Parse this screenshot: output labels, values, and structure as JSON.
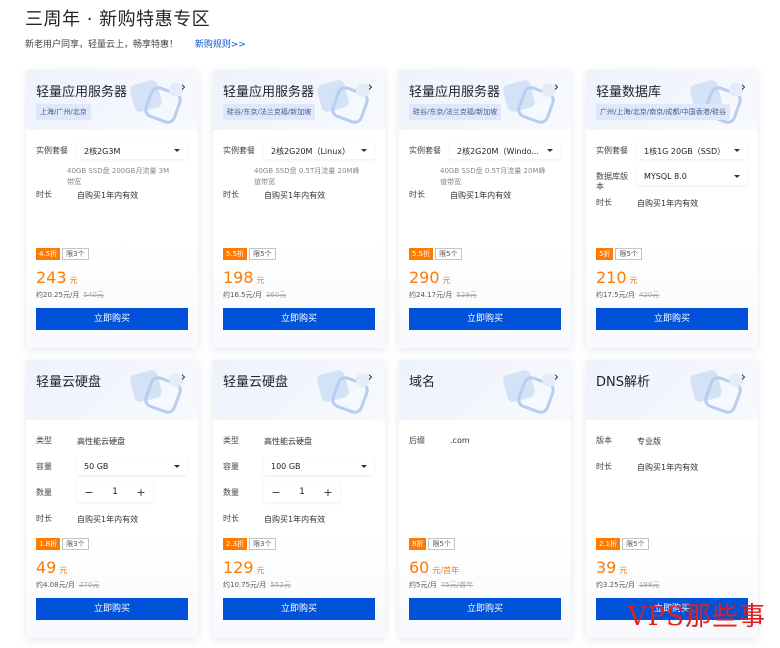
{
  "page": {
    "title": "三周年 · 新购特惠专区",
    "subtitle": "新老用户同享，轻量云上，畅享特惠！",
    "rules_link": "新购规则>>"
  },
  "cards": [
    {
      "title": "轻量应用服务器",
      "region": "上海/广州/北京",
      "rows": [
        {
          "label": "实例套餐",
          "select": "2核2G3M"
        },
        {
          "label": "时长",
          "value": "自购买1年内有效"
        }
      ],
      "spec_desc_1": "40GB SSD盘 200GB月流量 3M",
      "spec_desc_2": "带宽",
      "discount": "4.5折",
      "limit": "限3个",
      "price": "243",
      "price_unit": "元",
      "per_month": "约20.25元/月",
      "orig_price": "540元",
      "buy": "立即购买"
    },
    {
      "title": "轻量应用服务器",
      "region": "硅谷/东京/法兰克福/新加坡",
      "rows": [
        {
          "label": "实例套餐",
          "select": "2核2G20M（Linux）"
        },
        {
          "label": "时长",
          "value": "自购买1年内有效"
        }
      ],
      "spec_desc_1": "40GB SSD盘 0.5T月流量 20M峰",
      "spec_desc_2": "值带宽",
      "discount": "5.5折",
      "limit": "限5个",
      "price": "198",
      "price_unit": "元",
      "per_month": "约16.5元/月",
      "orig_price": "360元",
      "buy": "立即购买"
    },
    {
      "title": "轻量应用服务器",
      "region": "硅谷/东京/法兰克福/新加坡",
      "rows": [
        {
          "label": "实例套餐",
          "select": "2核2G20M（Windo..."
        },
        {
          "label": "时长",
          "value": "自购买1年内有效"
        }
      ],
      "spec_desc_1": "40GB SSD盘 0.5T月流量 20M峰",
      "spec_desc_2": "值带宽",
      "discount": "5.5折",
      "limit": "限5个",
      "price": "290",
      "price_unit": "元",
      "per_month": "约24.17元/月",
      "orig_price": "528元",
      "buy": "立即购买"
    },
    {
      "title": "轻量数据库",
      "region": "广州/上海/北京/南京/成都/中国香港/硅谷",
      "rows": [
        {
          "label": "实例套餐",
          "select": "1核1G 20GB（SSD）"
        },
        {
          "label": "数据库版本",
          "select": "MYSQL 8.0"
        },
        {
          "label": "时长",
          "value": "自购买1年内有效"
        }
      ],
      "discount": "5折",
      "limit": "限5个",
      "price": "210",
      "price_unit": "元",
      "per_month": "约17.5元/月",
      "orig_price": "420元",
      "buy": "立即购买"
    },
    {
      "title": "轻量云硬盘",
      "rows": [
        {
          "label": "类型",
          "value": "高性能云硬盘"
        },
        {
          "label": "容量",
          "select": "50 GB"
        },
        {
          "label": "数量",
          "stepper": "1"
        },
        {
          "label": "时长",
          "value": "自购买1年内有效"
        }
      ],
      "discount": "1.8折",
      "limit": "限3个",
      "price": "49",
      "price_unit": "元",
      "per_month": "约4.08元/月",
      "orig_price": "270元",
      "buy": "立即购买"
    },
    {
      "title": "轻量云硬盘",
      "rows": [
        {
          "label": "类型",
          "value": "高性能云硬盘"
        },
        {
          "label": "容量",
          "select": "100 GB"
        },
        {
          "label": "数量",
          "stepper": "1"
        },
        {
          "label": "时长",
          "value": "自购买1年内有效"
        }
      ],
      "discount": "2.3折",
      "limit": "限3个",
      "price": "129",
      "price_unit": "元",
      "per_month": "约10.75元/月",
      "orig_price": "552元",
      "buy": "立即购买"
    },
    {
      "title": "域名",
      "rows": [
        {
          "label": "后缀",
          "value": ".com"
        }
      ],
      "discount": "8折",
      "limit": "限5个",
      "price": "60",
      "price_unit": "元/首年",
      "per_month": "约5元/月",
      "orig_price": "75元/首年",
      "buy": "立即购买"
    },
    {
      "title": "DNS解析",
      "rows": [
        {
          "label": "版本",
          "value": "专业版"
        },
        {
          "label": "时长",
          "value": "自购买1年内有效"
        }
      ],
      "discount": "2.1折",
      "limit": "限5个",
      "price": "39",
      "price_unit": "元",
      "per_month": "约3.25元/月",
      "orig_price": "188元",
      "buy": "立即购买"
    }
  ],
  "watermark": "VPS那些事",
  "colors": {
    "accent": "#0052d9",
    "price": "#ff7a00",
    "watermark": "#e02020"
  }
}
